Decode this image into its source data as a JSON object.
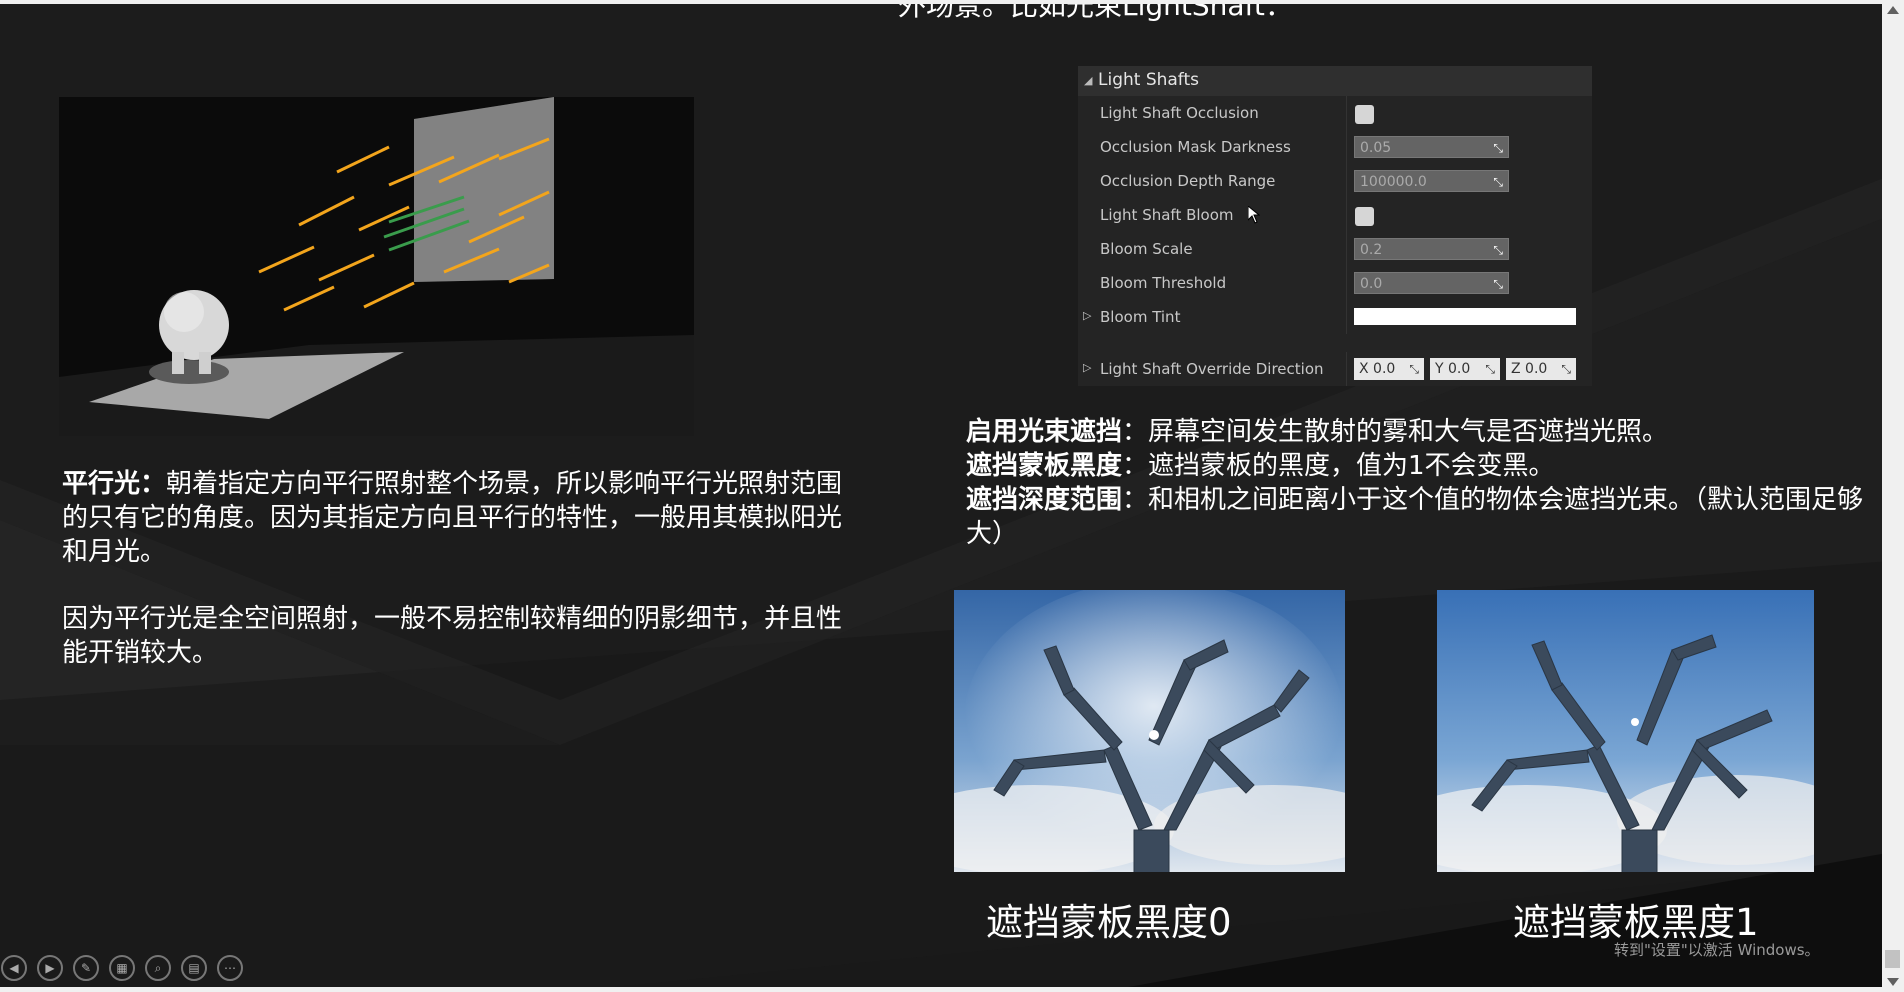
{
  "slide": {
    "top_text": "外场景。比如光束LightShaft：",
    "left_para1_bold": "平行光：",
    "left_para1_text": "朝着指定方向平行照射整个场景，所以影响平行光照射范围的只有它的角度。因为其指定方向且平行的特性，一般用其模拟阳光和月光。",
    "left_para2": "因为平行光是全空间照射，一般不易控制较精细的阴影细节，并且性能开销较大。",
    "desc": [
      {
        "bold": "启用光束遮挡",
        "text": "：屏幕空间发生散射的雾和大气是否遮挡光照。"
      },
      {
        "bold": "遮挡蒙板黑度",
        "text": "：遮挡蒙板的黑度，值为1不会变黑。"
      },
      {
        "bold": "遮挡深度范围",
        "text": "：和相机之间距离小于这个值的物体会遮挡光束。（默认范围足够大）"
      }
    ],
    "caption_left": "遮挡蒙板黑度0",
    "caption_right": "遮挡蒙板黑度1"
  },
  "panel": {
    "title": "Light Shafts",
    "rows": {
      "occlusion": "Light Shaft Occlusion",
      "mask_darkness": "Occlusion Mask Darkness",
      "mask_darkness_val": "0.05",
      "depth_range": "Occlusion Depth Range",
      "depth_range_val": "100000.0",
      "bloom": "Light Shaft Bloom",
      "bloom_scale": "Bloom Scale",
      "bloom_scale_val": "0.2",
      "bloom_threshold": "Bloom Threshold",
      "bloom_threshold_val": "0.0",
      "bloom_tint": "Bloom Tint",
      "override_dir": "Light Shaft Override Direction",
      "x": "X  0.0",
      "y": "Y  0.0",
      "z": "Z  0.0"
    }
  },
  "watermark": "转到\"设置\"以激活 Windows。",
  "icons": {
    "controls": [
      "prev-icon",
      "next-icon",
      "pen-icon",
      "slides-icon",
      "zoom-icon",
      "subtitle-icon",
      "more-icon"
    ]
  },
  "colors": {
    "arrow": "#f3a51c",
    "arrow_green": "#3a9c4c",
    "panel_bg": "#242424"
  }
}
